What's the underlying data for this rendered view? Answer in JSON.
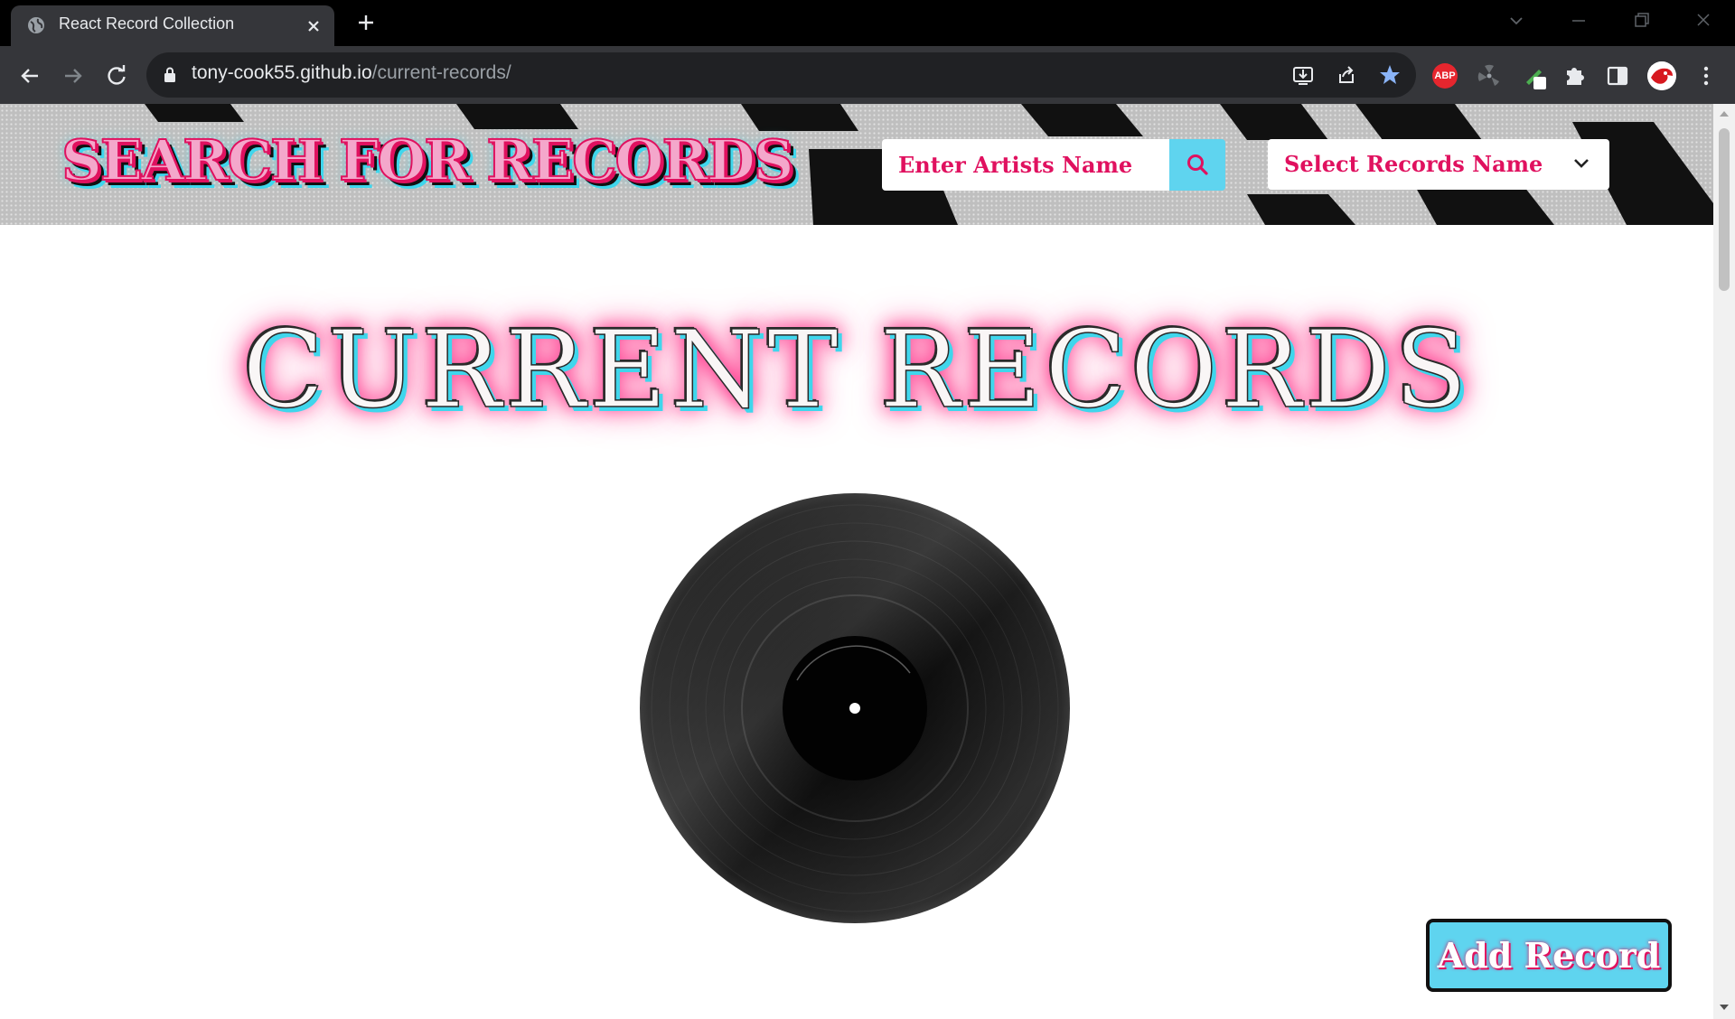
{
  "browser": {
    "tab_title": "React Record Collection",
    "url_host": "tony-cook55.github.io",
    "url_path": "/current-records/",
    "extensions": {
      "abp_label": "ABP"
    }
  },
  "header": {
    "title": "SEARCH FOR RECORDS",
    "search": {
      "placeholder": "Enter Artists Name"
    },
    "select": {
      "selected": "Select Records Name"
    }
  },
  "main": {
    "title": "CURRENT RECORDS",
    "add_button_label": "Add Record"
  },
  "colors": {
    "pink": "#e0115f",
    "cyan": "#5fd4ef",
    "chrome_dark": "#35363a"
  }
}
